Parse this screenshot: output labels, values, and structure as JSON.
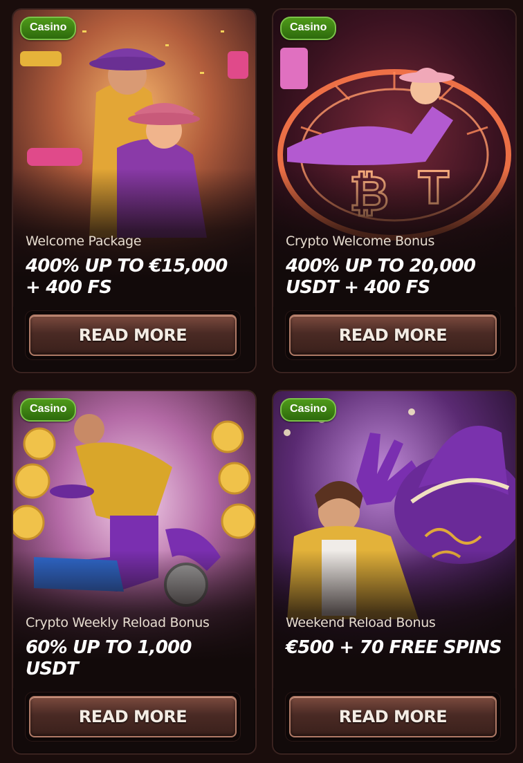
{
  "cards": [
    {
      "badge": "Casino",
      "subtitle": "Welcome Package",
      "headline": "400% UP TO €15,000 + 400 FS",
      "button": "READ MORE"
    },
    {
      "badge": "Casino",
      "subtitle": "Crypto Welcome Bonus",
      "headline": "400% UP TO 20,000 USDT + 400 FS",
      "button": "READ MORE"
    },
    {
      "badge": "Casino",
      "subtitle": "Crypto Weekly Reload Bonus",
      "headline": "60% UP TO 1,000 USDT",
      "button": "READ MORE"
    },
    {
      "badge": "Casino",
      "subtitle": "Weekend Reload Bonus",
      "headline": "€500 + 70 FREE SPINS",
      "button": "READ MORE"
    }
  ],
  "colors": {
    "page_background": "#1a0d0c",
    "badge_green": "#3f8a14",
    "button_brown": "#5a342c",
    "accent_purple": "#7a2fa8",
    "accent_gold": "#e0a83a"
  },
  "art": [
    "cowboy-couple-illustration",
    "crypto-roulette-wheel-illustration",
    "cowboy-boot-crypto-coins-illustration",
    "cowboy-purple-hat-illustration"
  ]
}
